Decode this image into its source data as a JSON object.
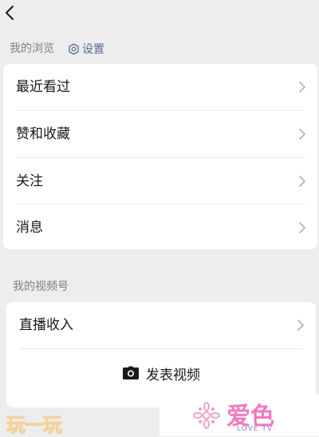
{
  "header": {
    "back_icon": "chevron-left-icon"
  },
  "browse_section": {
    "label": "我的浏览",
    "settings_label": "设置",
    "settings_icon": "gear-icon",
    "items": [
      {
        "label": "最近看过"
      },
      {
        "label": "赞和收藏"
      },
      {
        "label": "关注"
      },
      {
        "label": "消息"
      }
    ]
  },
  "channels_section": {
    "label": "我的视频号",
    "items": [
      {
        "label": "直播收入"
      }
    ],
    "post_label": "发表视频",
    "post_icon": "camera-icon"
  },
  "watermarks": {
    "left_text": "玩一玩",
    "right_brand": "爱色",
    "right_sub": "LOVE TV"
  },
  "colors": {
    "link": "#576b95",
    "background": "#ededed",
    "card": "#ffffff"
  }
}
